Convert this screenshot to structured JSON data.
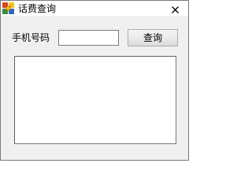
{
  "window": {
    "title": "话费查询",
    "close_glyph": "✕",
    "icon": "app-icon"
  },
  "form": {
    "phone_label": "手机号码",
    "phone_value": "",
    "query_button": "查询",
    "result_text": ""
  },
  "colors": {
    "icon_red": "#d9442b",
    "icon_yellow": "#f3c21b",
    "icon_green": "#3a8f3a",
    "icon_blue": "#3466c0"
  }
}
